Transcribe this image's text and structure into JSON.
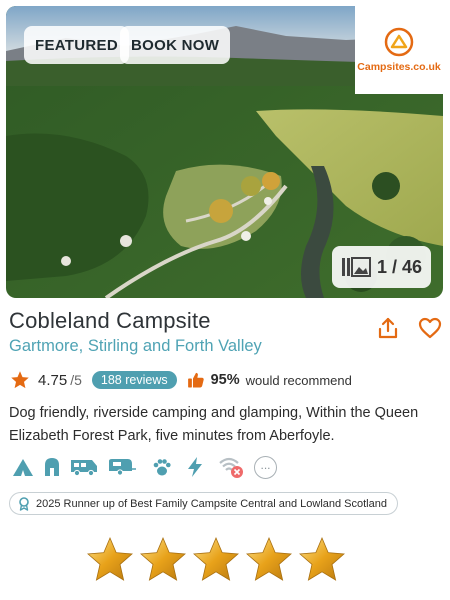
{
  "photo": {
    "badges": {
      "featured": "FEATURED",
      "book_now": "BOOK NOW"
    },
    "counter": "1 / 46",
    "gallery_icon": "gallery-icon"
  },
  "logo": {
    "text": "Campsites.co.uk",
    "icon": "tent-logo-icon",
    "color": "#e46a13"
  },
  "campsite": {
    "name": "Cobleland Campsite",
    "location": "Gartmore, Stirling and Forth Valley",
    "rating": "4.75",
    "rating_max": "/5",
    "reviews": "188 reviews",
    "recommend_pct": "95%",
    "recommend_text": "would recommend",
    "description": "Dog friendly, riverside camping and glamping, Within the Queen Elizabeth Forest Park, five minutes from Aberfoyle.",
    "award": "2025 Runner up of Best Family Campsite Central and Lowland Scotland"
  },
  "actions": {
    "share_icon": "share-icon",
    "favorite_icon": "heart-icon"
  },
  "amenities": [
    "tent-icon",
    "glamping-pod-icon",
    "motorhome-icon",
    "caravan-icon",
    "pet-paw-icon",
    "electric-hookup-icon",
    "no-wifi-icon",
    "more-icon"
  ],
  "star_rating": {
    "value": 5,
    "max": 5
  },
  "colors": {
    "accent": "#e46a13",
    "teal": "#4fa3b4",
    "star_gold": "#e8a21a"
  }
}
